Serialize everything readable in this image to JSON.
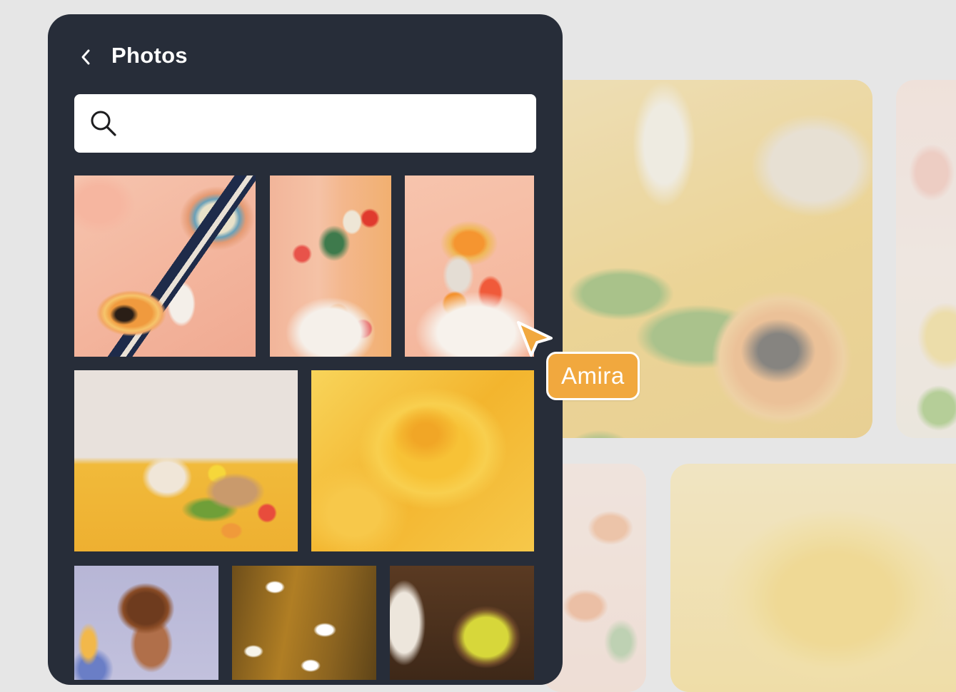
{
  "panel": {
    "title": "Photos",
    "back_icon": "chevron-left-icon",
    "search": {
      "icon": "search-icon",
      "placeholder": "",
      "value": ""
    },
    "photos": [
      {
        "id": "papaya-scarf-pink",
        "colors": [
          "#f6c4ae",
          "#f09a3e",
          "#1e2b4a"
        ]
      },
      {
        "id": "still-life-vases-peach",
        "colors": [
          "#f2b59a",
          "#3e7a4c",
          "#f08a38"
        ]
      },
      {
        "id": "orange-flowers-vase",
        "colors": [
          "#f7c4ad",
          "#f59530",
          "#f05a3a"
        ]
      },
      {
        "id": "picnic-yellow-cloth",
        "colors": [
          "#e8e1dc",
          "#f1ba3a",
          "#6f9f38"
        ]
      },
      {
        "id": "yellow-flower-closeup",
        "colors": [
          "#f8d45a",
          "#f1a626"
        ]
      },
      {
        "id": "woman-curly-hair",
        "colors": [
          "#b7b6d6",
          "#6e3b1e"
        ]
      },
      {
        "id": "daisies-motion-blur",
        "colors": [
          "#b07e24",
          "#ffffff"
        ]
      },
      {
        "id": "yellow-flowers-bowl",
        "colors": [
          "#5a3a22",
          "#d7d73a"
        ]
      }
    ]
  },
  "collaborator": {
    "name": "Amira",
    "color": "#f1a83e",
    "cursor_icon": "pointer-cursor-icon"
  },
  "canvas": {
    "background": "#e6e6e6"
  }
}
